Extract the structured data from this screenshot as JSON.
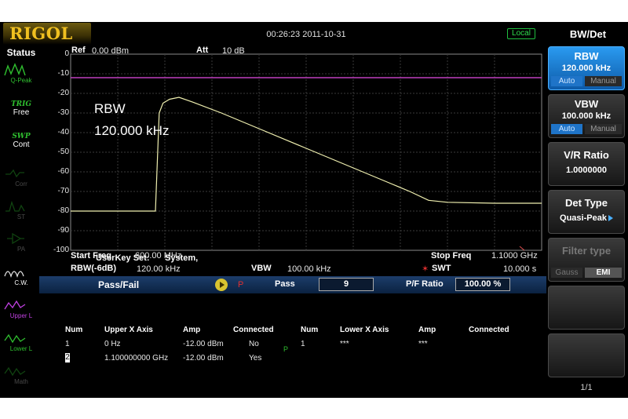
{
  "header": {
    "logo": "RIGOL",
    "datetime": "00:26:23 2011-10-31",
    "mode": "Local"
  },
  "status": {
    "title": "Status",
    "detector_label": "Q-Peak",
    "trig_title": "TRIG",
    "trig_value": "Free",
    "swp_title": "SWP",
    "swp_value": "Cont",
    "corr_label": "Corr",
    "st_label": "ST",
    "pa_label": "PA",
    "cw_label": "C.W.",
    "upper_label": "Upper L",
    "lower_label": "Lower L",
    "math_label": "Math"
  },
  "display": {
    "ref_label": "Ref",
    "ref_value": "0.00 dBm",
    "att_label": "Att",
    "att_value": "10 dB",
    "y_ticks": [
      "0",
      "-10",
      "-20",
      "-30",
      "-40",
      "-50",
      "-60",
      "-70",
      "-80",
      "-90",
      "-100"
    ],
    "overlay_line1": "RBW",
    "overlay_line2": "120.000 kHz",
    "userkey_label": "UserKey Set:",
    "userkey_value": "System,",
    "start_freq_label": "Start Freq",
    "start_freq_value": "600.00 MHz",
    "stop_freq_label": "Stop Freq",
    "stop_freq_value": "1.1000 GHz",
    "rbw_label": "RBW(-6dB)",
    "rbw_value": "120.00 kHz",
    "vbw_label": "VBW",
    "vbw_value": "100.00 kHz",
    "swt_mark": "✶",
    "swt_label": "SWT",
    "swt_value": "10.000 s",
    "limit_line_color": "#c040c0",
    "trace_color": "#f0f0b0"
  },
  "chart_data": {
    "type": "line",
    "xlim": [
      600,
      1100
    ],
    "ylim": [
      -100,
      0
    ],
    "reference_line": -12,
    "x": [
      600,
      620,
      640,
      660,
      680,
      690,
      692,
      694,
      698,
      705,
      715,
      730,
      760,
      800,
      850,
      900,
      940,
      960,
      980,
      1000,
      1050,
      1100
    ],
    "y": [
      -80,
      -80,
      -80,
      -80,
      -80,
      -80,
      -55,
      -30,
      -25,
      -23,
      -22,
      -24.5,
      -30,
      -38,
      -48,
      -58,
      -66,
      -70,
      -74.5,
      -75.5,
      -76,
      -76
    ]
  },
  "passfail": {
    "title": "Pass/Fail",
    "result_mark": "P",
    "pass_label": "Pass",
    "pass_value": "9",
    "ratio_label": "P/F Ratio",
    "ratio_value": "100.00 %",
    "headers": [
      "Num",
      "Upper X Axis",
      "Amp",
      "Connected",
      "Num",
      "Lower X Axis",
      "Amp",
      "Connected"
    ],
    "upper_rows": [
      {
        "num": "1",
        "x": "0 Hz",
        "amp": "-12.00 dBm",
        "connected": "No"
      },
      {
        "num": "2",
        "x": "1.100000000 GHz",
        "amp": "-12.00 dBm",
        "connected": "Yes"
      }
    ],
    "lower_rows": [
      {
        "num": "1",
        "x": "***",
        "amp": "***"
      }
    ],
    "p_mark": "P"
  },
  "menu": {
    "title": "BW/Det",
    "rbw": {
      "label": "RBW",
      "value": "120.000 kHz",
      "auto": "Auto",
      "manual": "Manual"
    },
    "vbw": {
      "label": "VBW",
      "value": "100.000 kHz",
      "auto": "Auto",
      "manual": "Manual"
    },
    "vr": {
      "label": "V/R Ratio",
      "value": "1.0000000"
    },
    "det": {
      "label": "Det Type",
      "value": "Quasi-Peak"
    },
    "filter": {
      "label": "Filter type",
      "gauss": "Gauss",
      "emi": "EMI"
    },
    "page": "1/1"
  }
}
